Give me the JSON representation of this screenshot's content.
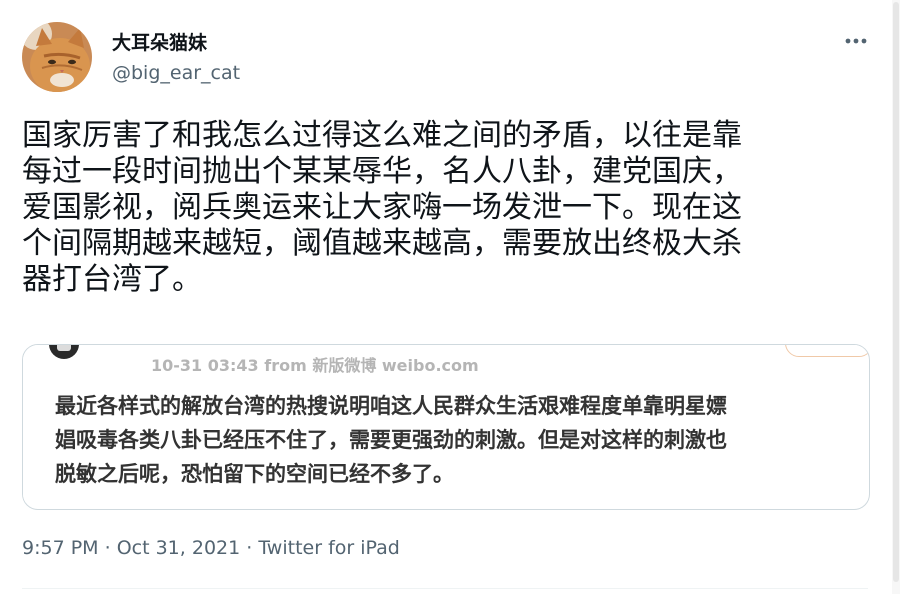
{
  "author": {
    "display_name": "大耳朵猫妹",
    "handle": "@big_ear_cat"
  },
  "tweet": {
    "text": "国家厉害了和我怎么过得这么难之间的矛盾，以往是靠\n每过一段时间抛出个某某辱华，名人八卦，建党国庆，\n爱国影视，阅兵奥运来让大家嗨一场发泄一下。现在这\n个间隔期越来越短，阈值越来越高，需要放出终极大杀\n器打台湾了。",
    "time": "9:57 PM",
    "separator": "·",
    "date": "Oct 31, 2021",
    "source": "Twitter for iPad"
  },
  "quoted_image": {
    "meta": "10-31 03:43  from 新版微博 weibo.com",
    "text": "最近各样式的解放台湾的热搜说明咱这人民群众生活艰难程度单靠明星嫖\n娼吸毒各类八卦已经压不住了，需要更强劲的刺激。但是对这样的刺激也\n脱敏之后呢，恐怕留下的空间已经不多了。"
  },
  "icons": {
    "more": "more-horizontal-icon"
  },
  "colors": {
    "primary_text": "#0f1419",
    "secondary_text": "#536471",
    "border": "#cfd9de"
  }
}
